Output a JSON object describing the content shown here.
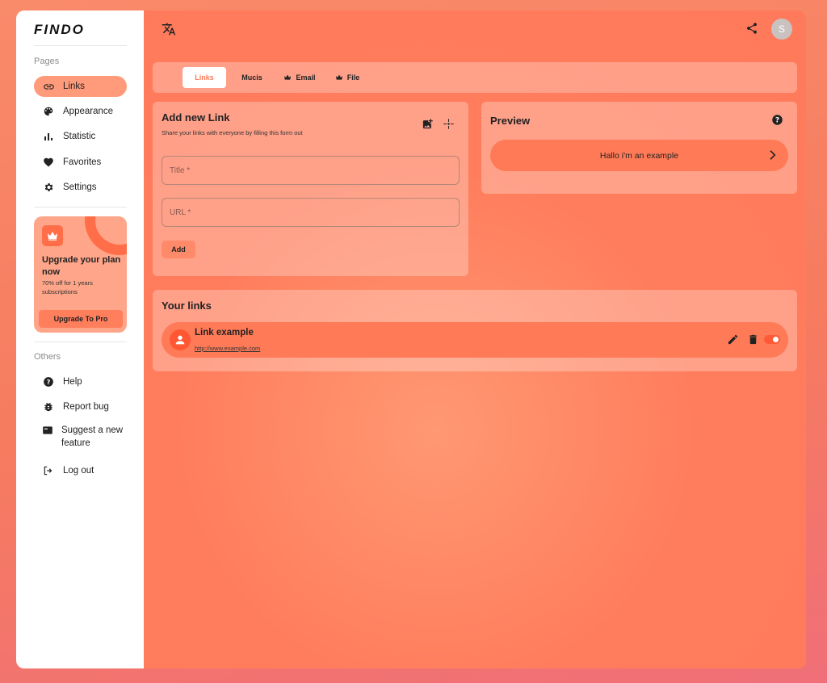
{
  "brand": {
    "logo": "FINDO"
  },
  "sidebar": {
    "pages_label": "Pages",
    "pages": [
      {
        "label": "Links",
        "icon": "link-icon",
        "active": true
      },
      {
        "label": "Appearance",
        "icon": "palette-icon"
      },
      {
        "label": "Statistic",
        "icon": "bar-chart-icon"
      },
      {
        "label": "Favorites",
        "icon": "heart-icon"
      },
      {
        "label": "Settings",
        "icon": "gear-icon"
      }
    ],
    "promo": {
      "title": "Upgrade your plan now",
      "subtitle": "70% off for 1 years subscriptions",
      "button": "Upgrade To Pro"
    },
    "others_label": "Others",
    "others": [
      {
        "label": "Help",
        "icon": "help-icon"
      },
      {
        "label": "Report bug",
        "icon": "bug-icon"
      },
      {
        "label": "Suggest a new feature",
        "icon": "feature-icon"
      },
      {
        "label": "Log out",
        "icon": "logout-icon"
      }
    ]
  },
  "header": {
    "avatar_initial": "S"
  },
  "tabs": [
    {
      "label": "Links",
      "active": true
    },
    {
      "label": "Mucis"
    },
    {
      "label": "Email",
      "premium": true
    },
    {
      "label": "File",
      "premium": true
    }
  ],
  "add_link": {
    "title": "Add new Link",
    "subtitle": "Share your links with everyone by filling this form out",
    "title_placeholder": "Title *",
    "url_placeholder": "URL *",
    "add_button": "Add"
  },
  "preview": {
    "title": "Preview",
    "example_link": "Hallo i'm an example"
  },
  "your_links": {
    "title": "Your links",
    "items": [
      {
        "title": "Link example",
        "url": "http://www.example.com",
        "enabled": true
      }
    ]
  },
  "colors": {
    "accent": "#ff7a57",
    "sidebar_bg": "#ffffff"
  }
}
